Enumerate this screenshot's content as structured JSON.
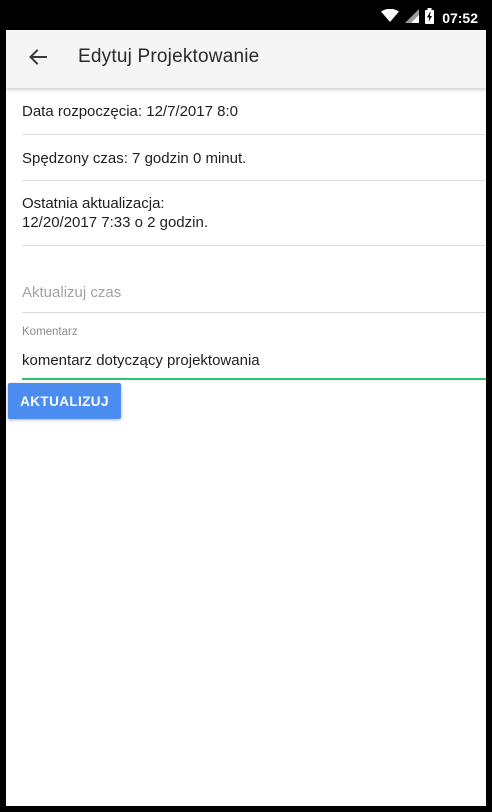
{
  "status_bar": {
    "time": "07:52",
    "icons": [
      "wifi-icon",
      "signal-icon",
      "battery-charging-icon"
    ]
  },
  "app_bar": {
    "back_icon": "arrow-left-icon",
    "title": "Edytuj Projektowanie"
  },
  "info": {
    "start_date": "Data rozpoczęcia: 12/7/2017 8:0",
    "time_spent": "Spędzony czas: 7 godzin 0 minut.",
    "last_update_line1": "Ostatnia aktualizacja:",
    "last_update_line2": "12/20/2017 7:33 o 2 godzin."
  },
  "form": {
    "update_time_placeholder": "Aktualizuj czas",
    "comment_label": "Komentarz",
    "comment_value": "komentarz dotyczący projektowania",
    "submit_label": "AKTUALIZUJ"
  },
  "colors": {
    "accent_button": "#4a8cf0",
    "focused_underline": "#2ec46c",
    "app_bar": "#f5f5f5"
  }
}
